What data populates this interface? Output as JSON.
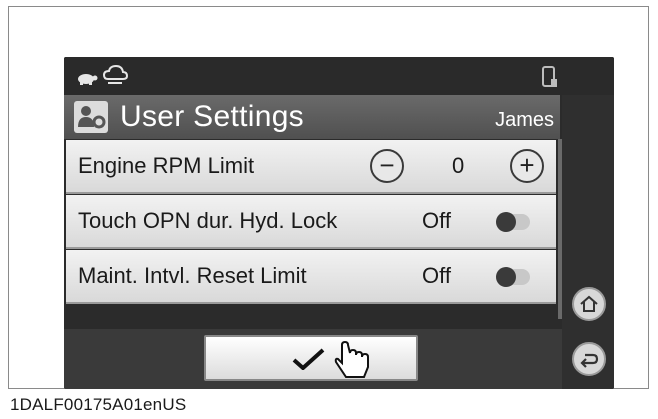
{
  "header": {
    "title": "User Settings",
    "user": "James"
  },
  "settings": [
    {
      "label": "Engine RPM Limit",
      "type": "stepper",
      "value": "0",
      "minus": "−",
      "plus": "+"
    },
    {
      "label": "Touch OPN dur. Hyd. Lock",
      "type": "toggle",
      "state": "Off",
      "on": false
    },
    {
      "label": "Maint. Intvl. Reset Limit",
      "type": "toggle",
      "state": "Off",
      "on": false
    }
  ],
  "confirm": {
    "glyph": "✓"
  },
  "side": {
    "home_icon": "home-icon",
    "back_icon": "back-icon"
  },
  "status": {
    "left_icons": [
      "turtle-icon",
      "cloud-icon"
    ],
    "right_icon": "phone-icon"
  },
  "caption": "1DALF00175A01enUS"
}
